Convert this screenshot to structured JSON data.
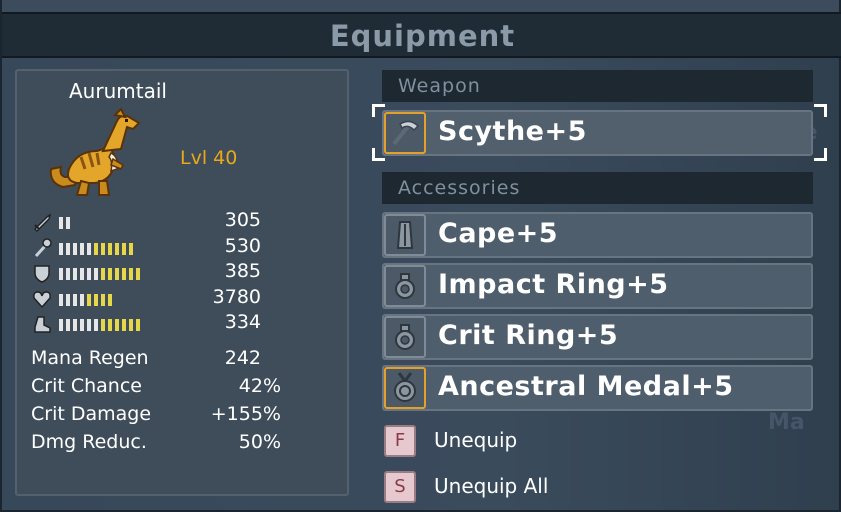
{
  "window": {
    "title": "Equipment"
  },
  "character": {
    "name": "Aurumtail",
    "level": "Lvl 40",
    "stats": [
      {
        "icon": "sword-icon",
        "value": "305",
        "pips_on": 2,
        "pips_total": 2
      },
      {
        "icon": "wand-icon",
        "value": "530",
        "pips_on": 11,
        "pips_total": 11
      },
      {
        "icon": "shield-icon",
        "value": "385",
        "pips_on": 12,
        "pips_total": 12
      },
      {
        "icon": "heart-icon",
        "value": "3780",
        "pips_on": 8,
        "pips_total": 8
      },
      {
        "icon": "boot-icon",
        "value": "334",
        "pips_on": 12,
        "pips_total": 12
      }
    ],
    "extra_stats": [
      {
        "label": "Mana Regen",
        "value": "242"
      },
      {
        "label": "Crit Chance",
        "value": "42%"
      },
      {
        "label": "Crit Damage",
        "value": "+155%"
      },
      {
        "label": "Dmg Reduc.",
        "value": "50%"
      }
    ]
  },
  "weapon_section": {
    "header": "Weapon",
    "item": {
      "name": "Scythe+5",
      "icon": "scythe-icon"
    }
  },
  "accessories_section": {
    "header": "Accessories",
    "items": [
      {
        "name": "Cape+5",
        "icon": "cape-icon"
      },
      {
        "name": "Impact Ring+5",
        "icon": "ring-icon"
      },
      {
        "name": "Crit Ring+5",
        "icon": "ring-icon"
      },
      {
        "name": "Ancestral Medal+5",
        "icon": "medal-icon"
      }
    ]
  },
  "actions": [
    {
      "key": "F",
      "label": "Unequip"
    },
    {
      "key": "S",
      "label": "Unequip All"
    }
  ],
  "colors": {
    "accent_gold": "#e3a12a",
    "level_orange": "#e8a81a",
    "pip_yellow": "#e6d64a",
    "pip_white": "#e6e6e6"
  }
}
